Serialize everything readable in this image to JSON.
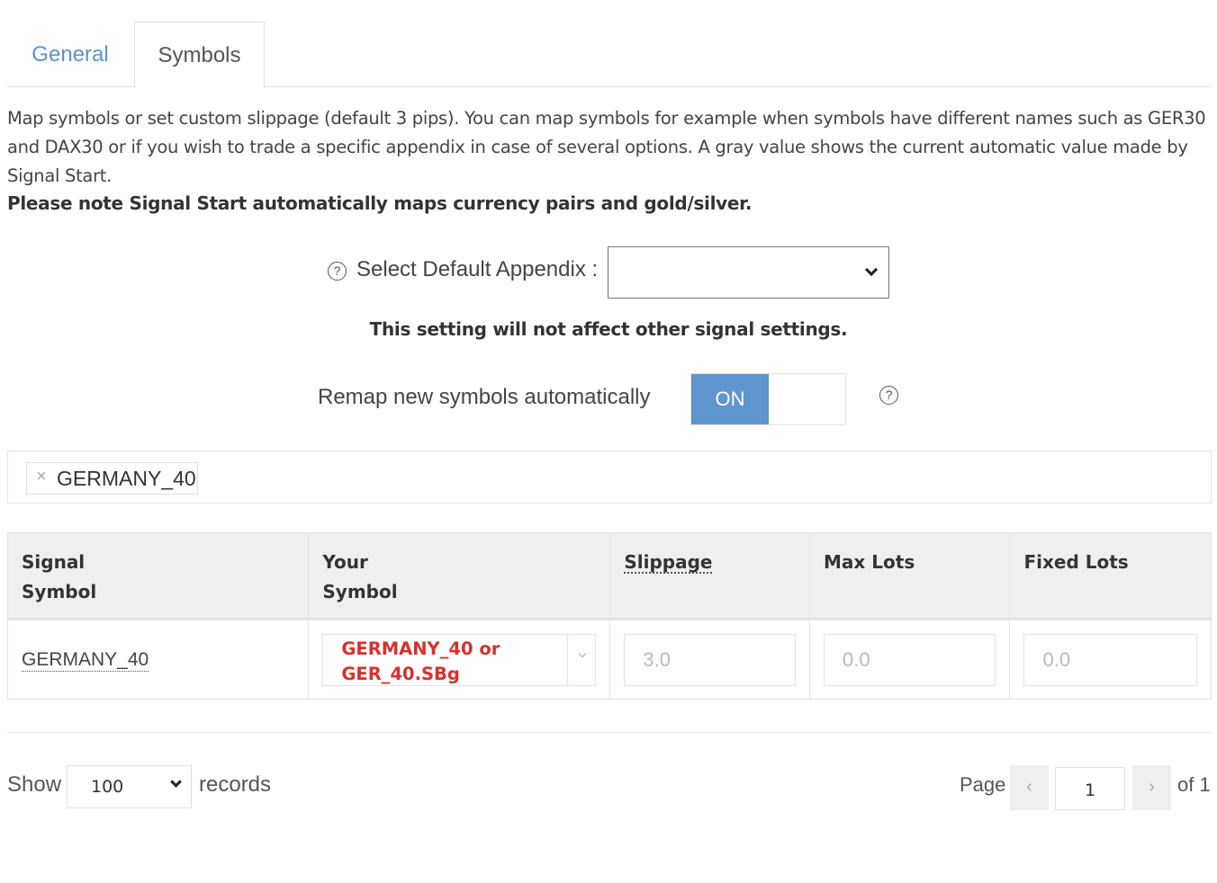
{
  "tabs": [
    {
      "label": "General",
      "active": false
    },
    {
      "label": "Symbols",
      "active": true
    }
  ],
  "description": {
    "text": "Map symbols or set custom slippage (default 3 pips). You can map symbols for example when symbols have different names such as GER30 and DAX30 or if you wish to trade a specific appendix in case of several options. A gray value shows the current automatic value made by Signal Start.",
    "note": "Please note Signal Start automatically maps currency pairs and gold/silver."
  },
  "appendix": {
    "help_icon": "question-circle-icon",
    "help_glyph": "?",
    "label": "Select Default Appendix :",
    "selected": "",
    "note": "This setting will not affect other signal settings."
  },
  "remap": {
    "label": "Remap new symbols automatically",
    "toggle_state": "ON",
    "help_glyph": "?"
  },
  "filter": {
    "tags": [
      {
        "remove_glyph": "×",
        "label": "GERMANY_40"
      }
    ]
  },
  "table": {
    "headers": {
      "signal_symbol": [
        "Signal",
        "Symbol"
      ],
      "your_symbol": [
        "Your",
        "Symbol"
      ],
      "slippage": "Slippage",
      "max_lots": "Max Lots",
      "fixed_lots": "Fixed Lots"
    },
    "rows": [
      {
        "signal_symbol": "GERMANY_40",
        "your_symbol": "GERMANY_40 or GER_40.SBg",
        "slippage": "3.0",
        "max_lots": "0.0",
        "fixed_lots": "0.0"
      }
    ]
  },
  "footer": {
    "show_label": "Show",
    "page_length": "100",
    "records_label": "records",
    "page_label": "Page",
    "prev_glyph": "‹",
    "current_page": "1",
    "next_glyph": "›",
    "of_label": "of 1"
  },
  "colors": {
    "accent": "#5e95cf",
    "tab_link": "#5b93cf",
    "error_red": "#d9302c"
  }
}
